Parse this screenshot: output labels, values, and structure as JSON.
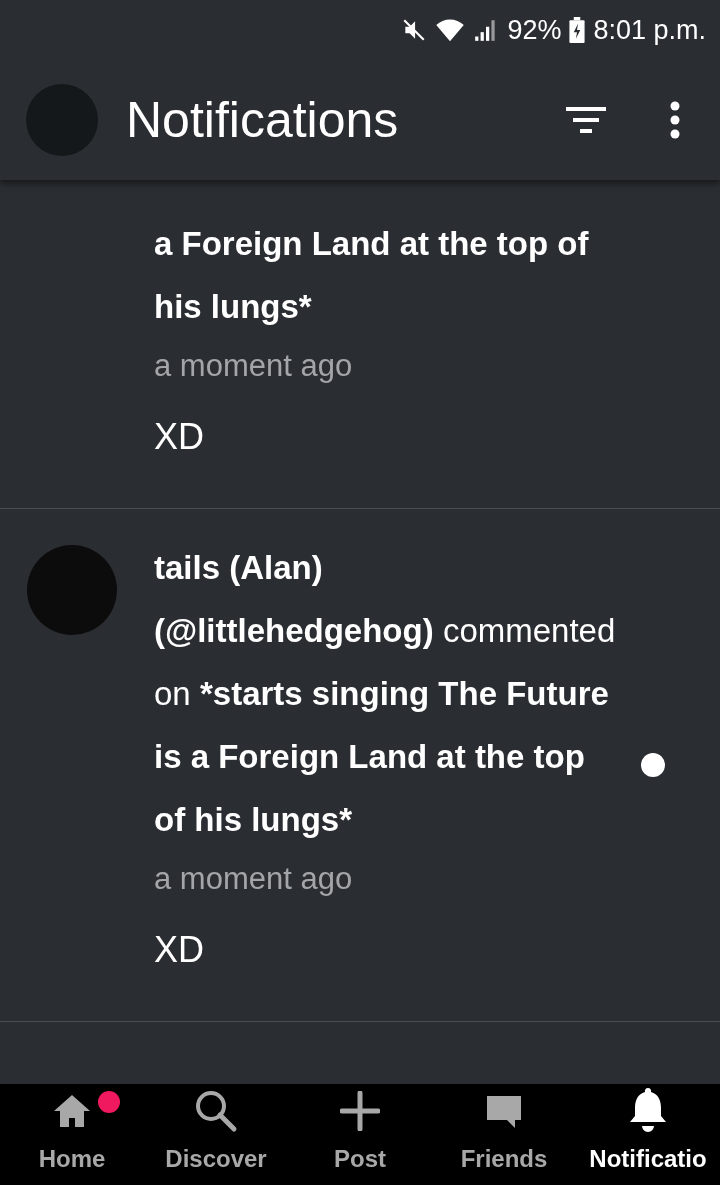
{
  "status_bar": {
    "battery": "92%",
    "time": "8:01 p.m."
  },
  "header": {
    "title": "Notifications"
  },
  "notifications": [
    {
      "target": "a Foreign Land at the top of his lungs*",
      "time": "a moment ago",
      "comment": "XD",
      "unread": false
    },
    {
      "actor": "tails (Alan) (@littlehedgehog)",
      "action": "commented on",
      "target": "*starts singing The Future is a Foreign Land at the top of his lungs*",
      "time": "a moment ago",
      "comment": "XD",
      "unread": true
    }
  ],
  "bottom_nav": [
    {
      "kind": "home",
      "label": "Home",
      "selected": false,
      "badge": true
    },
    {
      "kind": "discover",
      "label": "Discover",
      "selected": false,
      "badge": false
    },
    {
      "kind": "post",
      "label": "Post",
      "selected": false,
      "badge": false
    },
    {
      "kind": "friends",
      "label": "Friends",
      "selected": false,
      "badge": false
    },
    {
      "kind": "notifications",
      "label": "Notificatio",
      "selected": true,
      "badge": false
    }
  ]
}
